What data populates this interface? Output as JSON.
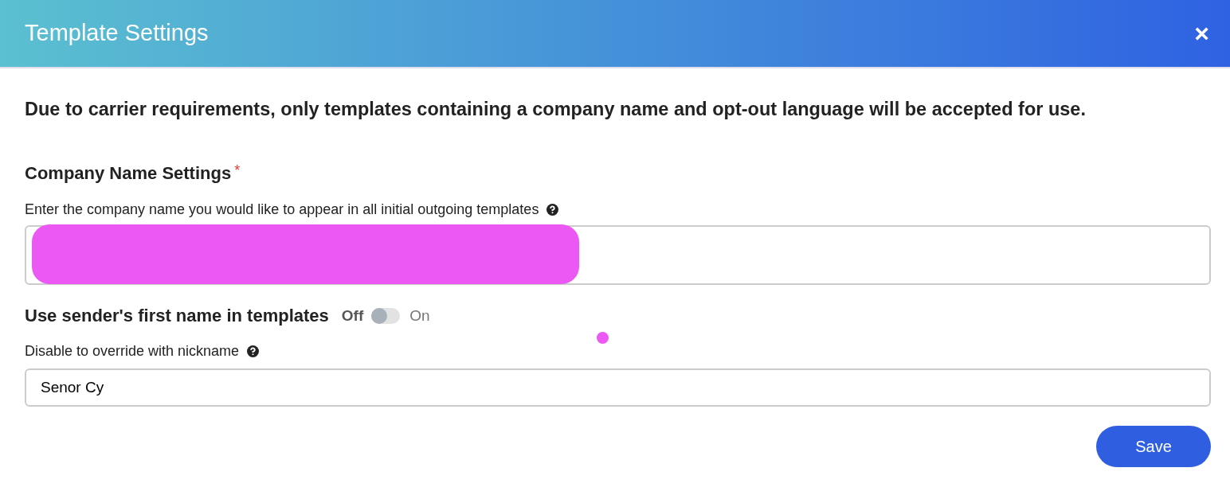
{
  "modal": {
    "title": "Template Settings",
    "close": "×"
  },
  "notice": "Due to carrier requirements, only templates containing a company name and opt-out language will be accepted for use.",
  "company_section": {
    "heading": "Company Name Settings",
    "required_mark": "*",
    "help": "Enter the company name you would like to appear in all initial outgoing templates",
    "redacted": true
  },
  "sender_toggle": {
    "label": "Use sender's first name in templates",
    "off_label": "Off",
    "on_label": "On",
    "on": false
  },
  "nickname": {
    "help": "Disable to override with nickname",
    "value": "Senor Cy"
  },
  "buttons": [
    {
      "label": "Save",
      "kind": "primary"
    }
  ]
}
